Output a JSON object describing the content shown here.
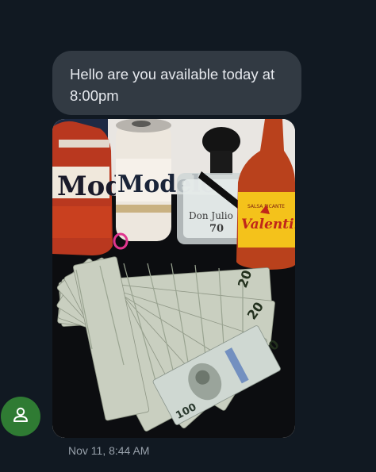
{
  "message": {
    "text": "Hello are you available today at 8:00pm",
    "timestamp": "Nov 11, 8:44 AM"
  },
  "photo": {
    "can_brand": "Modelo",
    "tequila_brand": "Don Julio",
    "tequila_label": "70",
    "hot_sauce_brand": "Valentina",
    "hot_sauce_tag": "SALSA PICANTE",
    "bill_denomination": "20",
    "bill_denomination_large": "100"
  },
  "avatar": {
    "icon": "person-icon"
  },
  "colors": {
    "background": "#111922",
    "bubble": "#323a43",
    "avatar": "#2f7b33",
    "text": "#e6e9ee",
    "timestamp": "#97a0aa"
  }
}
